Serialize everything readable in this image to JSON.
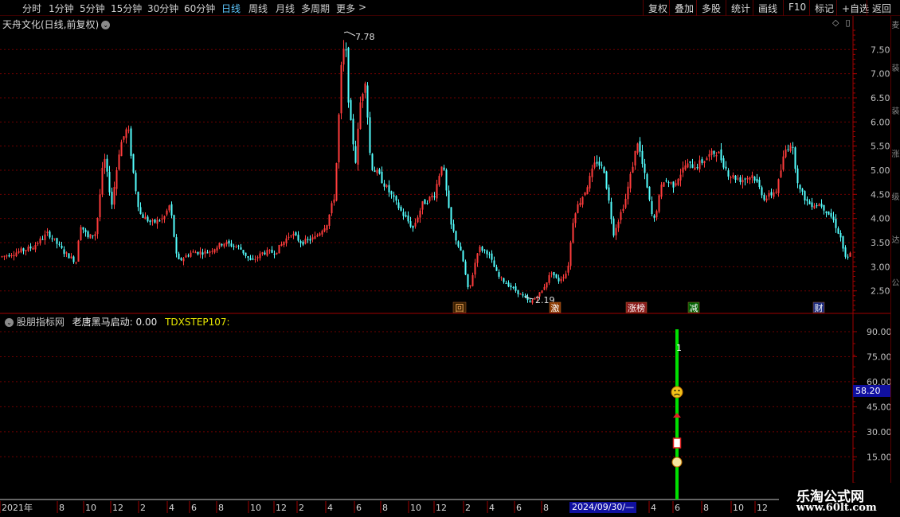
{
  "toolbar": {
    "periods": [
      "分时",
      "1分钟",
      "5分钟",
      "15分钟",
      "30分钟",
      "60分钟",
      "日线",
      "周线",
      "月线",
      "多周期",
      "更多"
    ],
    "active": "日线",
    "more_arrow": ">",
    "right": [
      "复权",
      "叠加",
      "多股",
      "统计",
      "画线",
      "F10",
      "标记",
      "+自选",
      "返回"
    ]
  },
  "chart": {
    "title": "天舟文化(日线,前复权)",
    "high_label": "7.78",
    "low_label": "2.19",
    "price_ticks": [
      "7.50",
      "7.00",
      "6.50",
      "6.00",
      "5.50",
      "5.00",
      "4.50",
      "4.00",
      "3.50",
      "3.00",
      "2.50"
    ],
    "markers": [
      "回",
      "激",
      "涨榜",
      "减",
      "财"
    ],
    "colors": {
      "up": "#ff3c3c",
      "down": "#54ffff",
      "grid": "#6e0000",
      "axis": "#a00000"
    }
  },
  "indicator": {
    "name": "股朋指标网",
    "formula_label": "老唐黑马启动:",
    "formula_value": "0.00",
    "step_label": "TDXSTEP107:",
    "ticks": [
      "90.00",
      "75.00",
      "60.00",
      "45.00",
      "30.00",
      "15.00"
    ],
    "signal_label": "1",
    "readout": "58.20",
    "colors": {
      "signal": "#00e000"
    }
  },
  "timeline": {
    "labels": [
      "2021年",
      "8",
      "10",
      "12",
      "2",
      "4",
      "6",
      "8",
      "10",
      "12",
      "2",
      "4",
      "6",
      "8",
      "10",
      "12",
      "2",
      "4",
      "6",
      "8",
      "4",
      "6",
      "8",
      "10",
      "12"
    ],
    "cursor_date": "2024/09/30/—"
  },
  "side_chars": [
    "麦",
    "装",
    "装",
    "涨",
    "级",
    "达",
    "公"
  ],
  "watermark": {
    "main": "乐淘公式网",
    "sub": "www.60lt.com"
  }
}
